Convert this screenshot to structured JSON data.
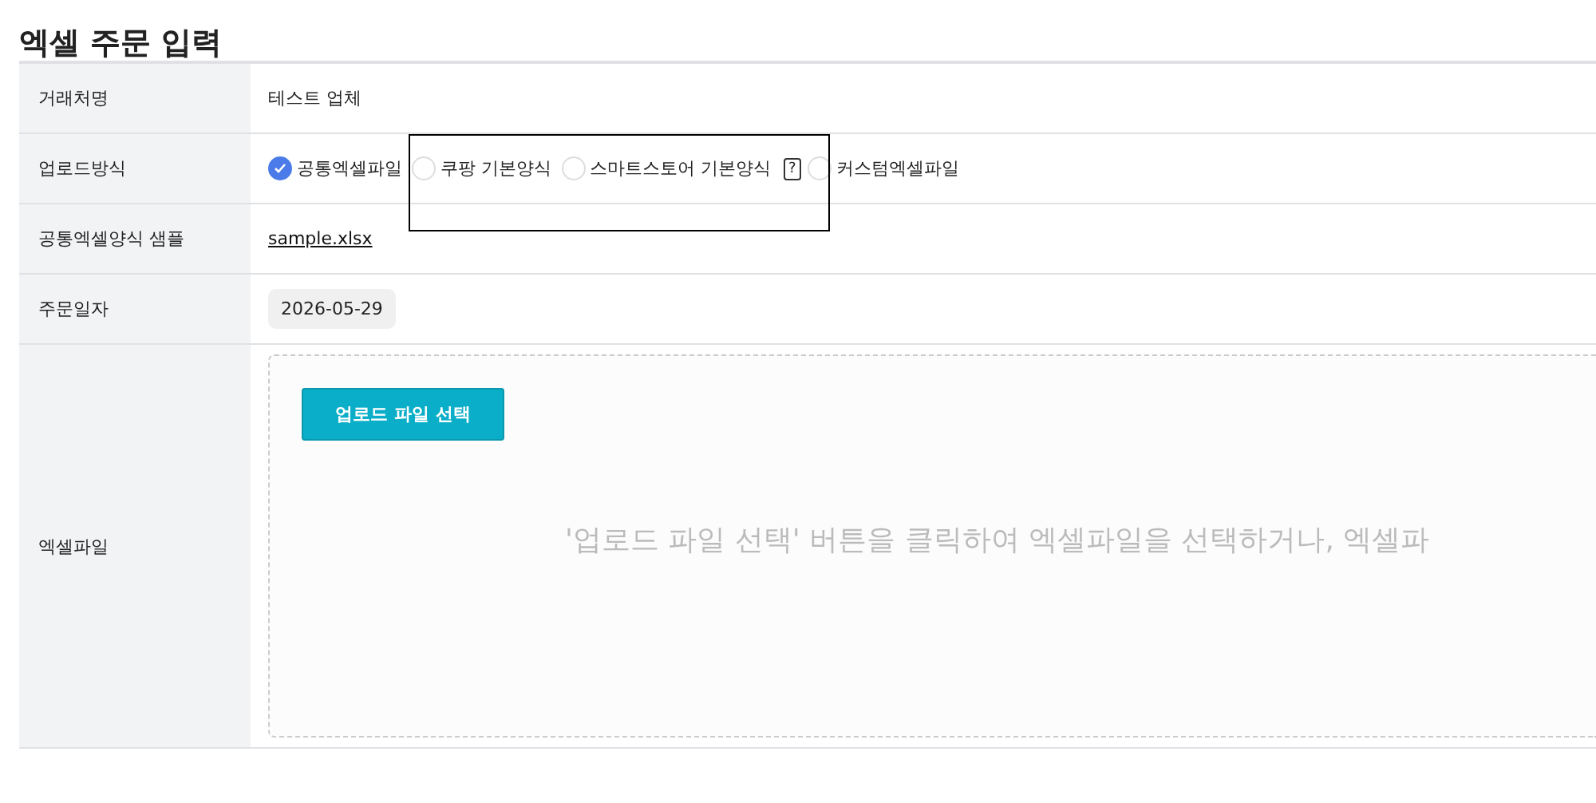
{
  "title": "엑셀 주문 입력",
  "rows": [
    {
      "kind": "text",
      "label": "거래처명",
      "value": "테스트 업체"
    },
    {
      "kind": "radios",
      "label": "업로드방식",
      "options": [
        {
          "label": "공통엑셀파일",
          "selected": true
        },
        {
          "label": "쿠팡 기본양식",
          "selected": false
        },
        {
          "label": "스마트스토어 기본양식",
          "selected": false,
          "help": "?"
        },
        {
          "label": "커스텀엑셀파일",
          "selected": false
        }
      ]
    },
    {
      "kind": "link",
      "label": "공통엑셀양식 샘플",
      "value": "sample.xlsx"
    },
    {
      "kind": "date",
      "label": "주문일자",
      "value": "2026-05-29"
    },
    {
      "kind": "upload",
      "label": "엑셀파일",
      "button": "업로드 파일 선택",
      "hint": "'업로드 파일 선택' 버튼을 클릭하여 엑셀파일을 선택하거나, 엑셀파"
    }
  ]
}
